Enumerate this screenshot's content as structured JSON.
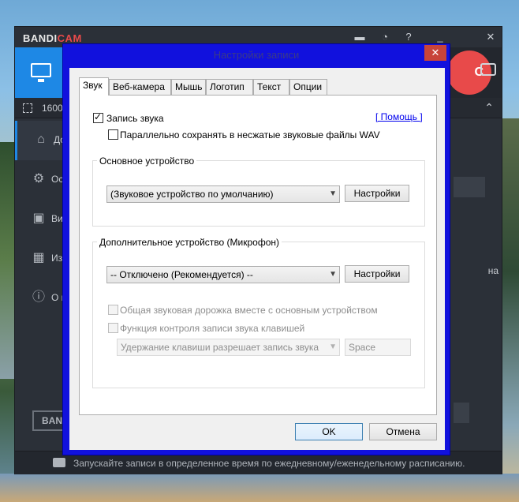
{
  "app": {
    "logo": "BANDI",
    "logo_accent": "CAM",
    "size_text": "1600x",
    "sidebar": [
      {
        "icon": "home-icon",
        "label": "До"
      },
      {
        "icon": "gear-icon",
        "label": "Ос"
      },
      {
        "icon": "video-icon",
        "label": "Ви"
      },
      {
        "icon": "image-icon",
        "label": "Из"
      },
      {
        "icon": "info-icon",
        "label": "О п"
      }
    ],
    "right_peek": "на",
    "bottom_button": "BAN",
    "status": "Запускайте записи в определенное время по ежедневному/еженедельному расписанию."
  },
  "dialog": {
    "title": "Настройки записи",
    "tabs": [
      "Звук",
      "Веб-камера",
      "Мышь",
      "Логотип",
      "Текст",
      "Опции"
    ],
    "active_tab": 0,
    "record_sound_label": "Запись звука",
    "record_sound_checked": true,
    "help_link": "[ Помощь ]",
    "save_wav_label": "Параллельно сохранять в несжатые звуковые файлы WAV",
    "save_wav_checked": false,
    "main_device": {
      "title": "Основное устройство",
      "selected": "(Звуковое устройство по умолчанию)",
      "settings_button": "Настройки"
    },
    "secondary_device": {
      "title": "Дополнительное устройство (Микрофон)",
      "selected": "-- Отключено (Рекомендуется) --",
      "settings_button": "Настройки",
      "mix_track_label": "Общая звуковая дорожка вместе с основным устройством",
      "hotkey_control_label": "Функция контроля записи звука клавишей",
      "hotkey_mode": "Удержание клавиши разрешает запись звука",
      "hotkey_value": "Space"
    },
    "ok_button": "OK",
    "cancel_button": "Отмена"
  },
  "colors": {
    "dialog_frame": "#1111dd",
    "close_button": "#c8443a",
    "record_button": "#e84a4a",
    "accent_blue": "#1e88e5"
  }
}
